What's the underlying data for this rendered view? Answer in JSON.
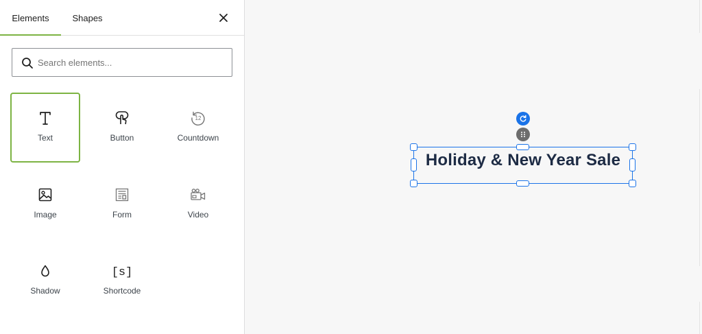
{
  "sidebar": {
    "tabs": [
      {
        "label": "Elements",
        "active": true
      },
      {
        "label": "Shapes",
        "active": false
      }
    ],
    "close_icon": "close-icon",
    "search": {
      "placeholder": "Search elements...",
      "value": ""
    },
    "elements": [
      {
        "label": "Text",
        "icon": "text-icon",
        "selected": true
      },
      {
        "label": "Button",
        "icon": "button-icon",
        "selected": false
      },
      {
        "label": "Countdown",
        "icon": "countdown-icon",
        "selected": false
      },
      {
        "label": "Image",
        "icon": "image-icon",
        "selected": false
      },
      {
        "label": "Form",
        "icon": "form-icon",
        "selected": false
      },
      {
        "label": "Video",
        "icon": "video-icon",
        "selected": false
      },
      {
        "label": "Shadow",
        "icon": "shadow-icon",
        "selected": false
      },
      {
        "label": "Shortcode",
        "icon": "shortcode-icon",
        "selected": false
      }
    ],
    "countdown_icon_text": "12",
    "shortcode_icon_text": "[s]"
  },
  "canvas": {
    "headline": "Holiday & New Year Sale",
    "selection_color": "#1a73e8",
    "headline_color": "#1d2b44"
  },
  "colors": {
    "accent": "#7cb342"
  }
}
